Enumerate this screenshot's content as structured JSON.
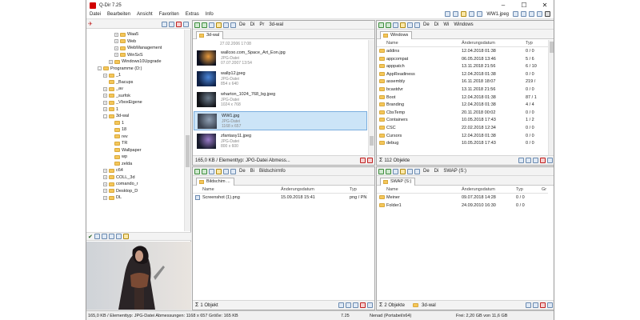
{
  "window": {
    "title": "Q-Dir 7.25"
  },
  "menu": [
    "Datei",
    "Bearbeiten",
    "Ansicht",
    "Favoriten",
    "Extras",
    "Info"
  ],
  "menu_right": {
    "path_label": "WW1.jpeg"
  },
  "left_tree": [
    {
      "label": "Waa5",
      "toggle": "+",
      "indent": 5
    },
    {
      "label": "Web",
      "toggle": "+",
      "indent": 5
    },
    {
      "label": "WebManagement",
      "toggle": "+",
      "indent": 5
    },
    {
      "label": "WinSxS",
      "toggle": "+",
      "indent": 5
    },
    {
      "label": "Windows10Upgrade",
      "toggle": "+",
      "indent": 4
    },
    {
      "label": "Programme (D:)",
      "toggle": "-",
      "indent": 2
    },
    {
      "label": "_1",
      "toggle": "+",
      "indent": 3
    },
    {
      "label": "_Bacups",
      "toggle": "",
      "indent": 3
    },
    {
      "label": "_av",
      "toggle": "+",
      "indent": 3
    },
    {
      "label": "_surfok",
      "toggle": "+",
      "indent": 3
    },
    {
      "label": "_VboxEigene",
      "toggle": "+",
      "indent": 3
    },
    {
      "label": "1",
      "toggle": "+",
      "indent": 3
    },
    {
      "label": "3d-wal",
      "toggle": "-",
      "indent": 3
    },
    {
      "label": "1",
      "toggle": "",
      "indent": 4
    },
    {
      "label": "18",
      "toggle": "",
      "indent": 4
    },
    {
      "label": "rev",
      "toggle": "",
      "indent": 4
    },
    {
      "label": "TR",
      "toggle": "",
      "indent": 4
    },
    {
      "label": "Wallpaper",
      "toggle": "",
      "indent": 4
    },
    {
      "label": "wp",
      "toggle": "",
      "indent": 4
    },
    {
      "label": "zelda",
      "toggle": "",
      "indent": 4
    },
    {
      "label": "c64",
      "toggle": "+",
      "indent": 3
    },
    {
      "label": "COLL_3d",
      "toggle": "+",
      "indent": 3
    },
    {
      "label": "comando_r",
      "toggle": "+",
      "indent": 3
    },
    {
      "label": "Desktop_D",
      "toggle": "+",
      "indent": 3
    },
    {
      "label": "DL",
      "toggle": "+",
      "indent": 3
    }
  ],
  "pane_tl": {
    "toolbar": [
      "De",
      "Di",
      "Pr",
      "3d-wal"
    ],
    "tab": "3d-wal",
    "items": [
      {
        "name": "",
        "type": "27.02.2006 17:08",
        "dim": "",
        "theme": "top"
      },
      {
        "name": "wallcoo.com_Space_Art_Eon.jpg",
        "type": "JPG-Datei",
        "dim": "07.07.2007 13:54",
        "theme": "space"
      },
      {
        "name": "wallp12.jpeg",
        "type": "JPG-Datei",
        "dim": "854 x 640",
        "theme": "blue"
      },
      {
        "name": "wharton_1024_768_bg.jpeg",
        "type": "JPG-Datei",
        "dim": "1024 x 768",
        "theme": "dark"
      },
      {
        "name": "WW1.jpg",
        "type": "JPG-Datei",
        "dim": "1168 x 657",
        "theme": "ww",
        "selected": true
      },
      {
        "name": "zfantasy11.jpeg",
        "type": "JPG-Datei",
        "dim": "800 x 600",
        "theme": "fantasy"
      }
    ],
    "status": "165,0 KB / Elementtyp: JPG-Datei Abmess..."
  },
  "pane_tr": {
    "toolbar": [
      "De",
      "Di",
      "Wi",
      "Windows"
    ],
    "tab": "Windows",
    "columns": [
      "Name",
      "Änderungsdatum",
      "Typ"
    ],
    "rows": [
      {
        "name": "addins",
        "date": "12.04.2018 01:38",
        "typ": "0 / 0"
      },
      {
        "name": "appcompat",
        "date": "06.05.2018 13:46",
        "typ": "5 / 6"
      },
      {
        "name": "apppatch",
        "date": "13.11.2018 21:56",
        "typ": "6 / 10"
      },
      {
        "name": "AppReadiness",
        "date": "12.04.2018 01:38",
        "typ": "0 / 0"
      },
      {
        "name": "assembly",
        "date": "16.11.2018 18:07",
        "typ": "219 /"
      },
      {
        "name": "bcastdvr",
        "date": "13.11.2018 21:56",
        "typ": "0 / 0"
      },
      {
        "name": "Boot",
        "date": "12.04.2018 01:38",
        "typ": "87 / 1"
      },
      {
        "name": "Branding",
        "date": "12.04.2018 01:38",
        "typ": "4 / 4"
      },
      {
        "name": "CbsTemp",
        "date": "20.11.2018 00:02",
        "typ": "0 / 0"
      },
      {
        "name": "Containers",
        "date": "10.05.2018 17:43",
        "typ": "1 / 2"
      },
      {
        "name": "CSC",
        "date": "22.02.2018 12:34",
        "typ": "0 / 0"
      },
      {
        "name": "Cursors",
        "date": "12.04.2018 01:38",
        "typ": "0 / 0"
      },
      {
        "name": "debug",
        "date": "10.05.2018 17:43",
        "typ": "0 / 0"
      }
    ],
    "status": "112 Objekte"
  },
  "pane_bl": {
    "toolbar": [
      "De",
      "Bi",
      "Bildschirmfo"
    ],
    "tab": "Bildschim ...",
    "columns": [
      "Name",
      "Änderungsdatum",
      "Typ"
    ],
    "rows": [
      {
        "name": "Screenshot (1).png",
        "date": "15.09.2018 15:41",
        "typ": "png / PN"
      }
    ],
    "status": "1 Objekt"
  },
  "pane_br": {
    "toolbar": [
      "De",
      "Di",
      "SWAP (S:)"
    ],
    "tab": "SWAP (S:)",
    "columns": [
      "Name",
      "Änderungsdatum",
      "Typ",
      "Gr"
    ],
    "rows": [
      {
        "name": "Meiner",
        "date": "09.07.2018 14:28",
        "typ": "0 / 0"
      },
      {
        "name": "Folder1",
        "date": "24.09.2010 16:30",
        "typ": "0 / 0"
      }
    ],
    "status": "2 Objekte",
    "status_path": "3d-wal"
  },
  "main_status": {
    "info": "165,0 KB / Elementtyp: JPG-Datei Abmessungen: 1168 x 657 Größe: 165 KB",
    "version": "7.25",
    "user": "Nenad (Portabel/x64)",
    "free": "Frei: 2,20 GB von 11,6 GB"
  },
  "colors": {
    "accent": "#3c7fd8",
    "folder": "#f4c65a",
    "selection": "#cce4f7"
  }
}
